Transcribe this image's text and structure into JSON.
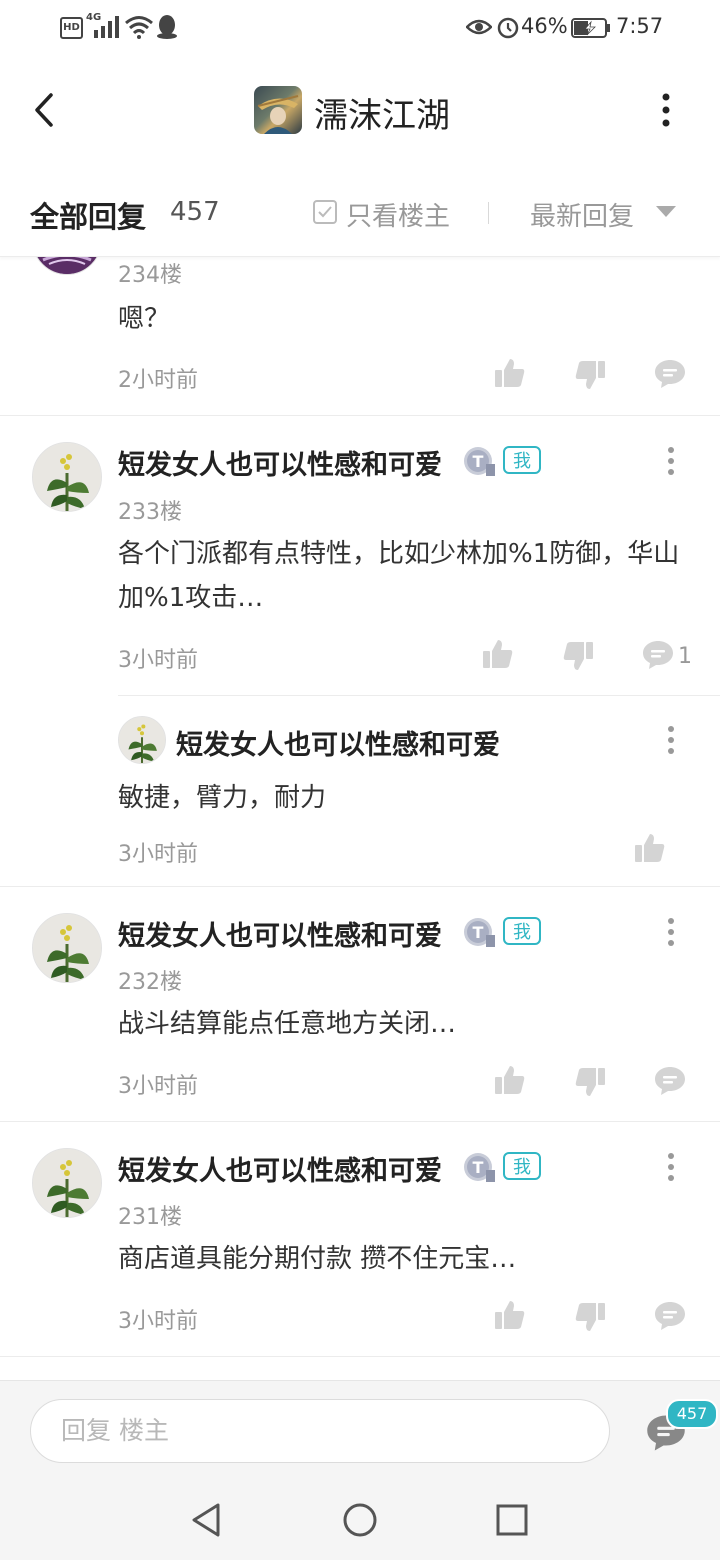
{
  "status_bar": {
    "hd": "HD",
    "network": "4G",
    "battery_percent": "46%",
    "time": "7:57",
    "battery_level": 0.46
  },
  "header": {
    "title": "濡沫江湖",
    "logo_icon": "game-logo-icon"
  },
  "tabs": {
    "all_replies_label": "全部回复",
    "all_replies_count": "457",
    "only_op_label": "只看楼主",
    "sort_label": "最新回复"
  },
  "posts": [
    {
      "floor": "234楼",
      "content": "嗯？",
      "time": "2小时前"
    },
    {
      "name": "短发女人也可以性感和可爱",
      "me_badge": "我",
      "floor": "233楼",
      "content": "各个门派都有点特性，比如少林加%1防御，华山加%1攻击…",
      "time": "3小时前",
      "reply_count": "1",
      "sub_reply": {
        "name": "短发女人也可以性感和可爱",
        "content": "敏捷，臂力，耐力",
        "time": "3小时前"
      }
    },
    {
      "name": "短发女人也可以性感和可爱",
      "me_badge": "我",
      "floor": "232楼",
      "content": "战斗结算能点任意地方关闭…",
      "time": "3小时前"
    },
    {
      "name": "短发女人也可以性感和可爱",
      "me_badge": "我",
      "floor": "231楼",
      "content": "商店道具能分期付款 攒不住元宝…",
      "time": "3小时前"
    }
  ],
  "bottom_bar": {
    "reply_placeholder": "回复  楼主",
    "comment_count": "457"
  },
  "colors": {
    "accent": "#30b6c4",
    "text_primary": "#222222",
    "text_secondary": "#999999",
    "icon_gray": "#d4d4d4"
  }
}
